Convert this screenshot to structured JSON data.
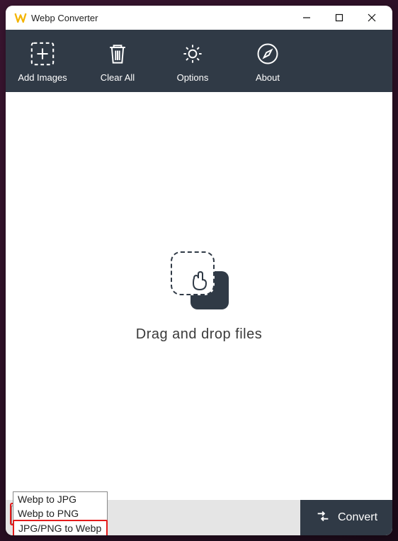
{
  "window": {
    "title": "Webp Converter"
  },
  "toolbar": {
    "add_images": "Add Images",
    "clear_all": "Clear All",
    "options": "Options",
    "about": "About"
  },
  "dropzone": {
    "text": "Drag and drop files"
  },
  "format_select": {
    "selected": "Webp to JPG",
    "options": [
      "Webp to JPG",
      "Webp to PNG",
      "JPG/PNG to Webp"
    ]
  },
  "convert": {
    "label": "Convert"
  },
  "colors": {
    "toolbar_bg": "#303a46",
    "highlight": "#e41b1b"
  }
}
